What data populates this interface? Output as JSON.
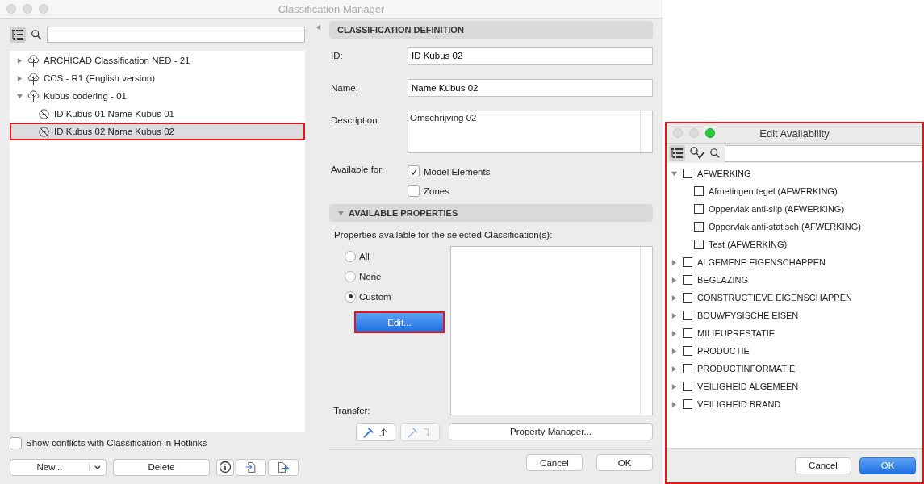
{
  "window": {
    "title": "Classification Manager"
  },
  "left_panel": {
    "tree": [
      {
        "label": "ARCHICAD Classification NED - 21",
        "expanded": false,
        "selected": false,
        "highlighted": false
      },
      {
        "label": "CCS - R1 (English version)",
        "expanded": false,
        "selected": false,
        "highlighted": false
      },
      {
        "label": "Kubus codering - 01",
        "expanded": true,
        "selected": false,
        "highlighted": false,
        "children": [
          {
            "label": "ID Kubus 01 Name Kubus 01",
            "selected": false,
            "highlighted": false
          },
          {
            "label": "ID Kubus 02 Name Kubus 02",
            "selected": true,
            "highlighted": true
          }
        ]
      }
    ],
    "show_conflicts": {
      "label": "Show conflicts with Classification in Hotlinks",
      "checked": false
    },
    "buttons": {
      "new": "New...",
      "delete": "Delete"
    }
  },
  "definition": {
    "header": "CLASSIFICATION DEFINITION",
    "id": {
      "label": "ID:",
      "value": "ID Kubus 02"
    },
    "name": {
      "label": "Name:",
      "value": "Name Kubus 02"
    },
    "description": {
      "label": "Description:",
      "value": "Omschrijving 02"
    },
    "available_for": {
      "label": "Available for:",
      "options": [
        {
          "label": "Model Elements",
          "checked": true
        },
        {
          "label": "Zones",
          "checked": false
        }
      ]
    }
  },
  "properties": {
    "header": "AVAILABLE PROPERTIES",
    "expanded": true,
    "caption": "Properties available for the selected Classification(s):",
    "radios": [
      {
        "label": "All",
        "selected": false
      },
      {
        "label": "None",
        "selected": false
      },
      {
        "label": "Custom",
        "selected": true
      }
    ],
    "edit_button": {
      "label": "Edit...",
      "highlighted": true
    },
    "transfer_label": "Transfer:",
    "property_manager": "Property Manager..."
  },
  "footer": {
    "cancel": "Cancel",
    "ok": "OK"
  },
  "edit_availability": {
    "title": "Edit Availability",
    "highlighted": true,
    "tree": [
      {
        "label": "AFWERKING",
        "expanded": true,
        "checked": false,
        "children": [
          {
            "label": "Afmetingen tegel (AFWERKING)",
            "checked": false
          },
          {
            "label": "Oppervlak anti-slip (AFWERKING)",
            "checked": false
          },
          {
            "label": "Oppervlak anti-statisch (AFWERKING)",
            "checked": false
          },
          {
            "label": "Test (AFWERKING)",
            "checked": false
          }
        ]
      },
      {
        "label": "ALGEMENE EIGENSCHAPPEN",
        "expanded": false,
        "checked": false
      },
      {
        "label": "BEGLAZING",
        "expanded": false,
        "checked": false
      },
      {
        "label": "CONSTRUCTIEVE EIGENSCHAPPEN",
        "expanded": false,
        "checked": false
      },
      {
        "label": "BOUWFYSISCHE EISEN",
        "expanded": false,
        "checked": false
      },
      {
        "label": "MILIEUPRESTATIE",
        "expanded": false,
        "checked": false
      },
      {
        "label": "PRODUCTIE",
        "expanded": false,
        "checked": false
      },
      {
        "label": "PRODUCTINFORMATIE",
        "expanded": false,
        "checked": false
      },
      {
        "label": "VEILIGHEID ALGEMEEN",
        "expanded": false,
        "checked": false
      },
      {
        "label": "VEILIGHEID BRAND",
        "expanded": false,
        "checked": false
      }
    ],
    "cancel": "Cancel",
    "ok": "OK"
  }
}
